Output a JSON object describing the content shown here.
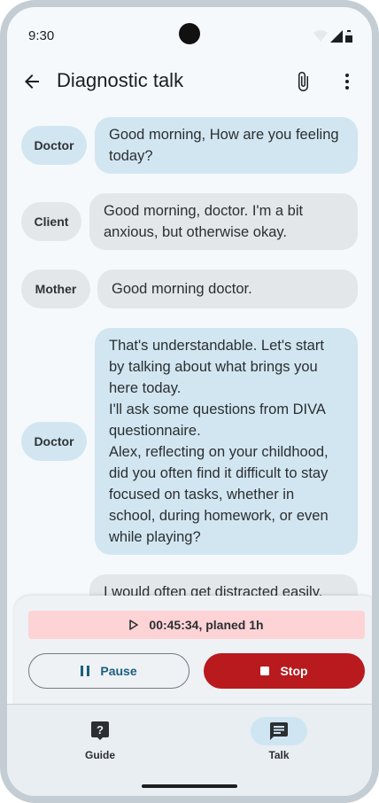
{
  "status_bar": {
    "time": "9:30"
  },
  "app_bar": {
    "title": "Diagnostic talk"
  },
  "messages": [
    {
      "speaker": "Doctor",
      "text": "Good morning, How are you feeling\ntoday?"
    },
    {
      "speaker": "Client",
      "text": "Good morning, doctor. I'm a bit\nanxious, but otherwise okay."
    },
    {
      "speaker": "Mother",
      "text": "Good morning doctor."
    },
    {
      "speaker": "Doctor",
      "text": "That's understandable. Let's start\nby talking about what brings you\nhere today.\nI'll ask some questions from DIVA\nquestionnaire.\nAlex, reflecting on your childhood,\ndid you often find it difficult to stay\nfocused on tasks, whether in\nschool, during homework, or even\nwhile playing?"
    },
    {
      "speaker": "",
      "text": "I would often get distracted easily."
    }
  ],
  "session": {
    "timer_text": "00:45:34, planed 1h",
    "pause_label": "Pause",
    "stop_label": "Stop"
  },
  "nav": [
    {
      "label": "Guide",
      "icon": "guide-question-icon",
      "active": false
    },
    {
      "label": "Talk",
      "icon": "chat-icon",
      "active": true
    }
  ],
  "colors": {
    "doctor_bubble": "#d2e6f1",
    "other_bubble": "#e3e7ea",
    "stop": "#b81a1e",
    "timer_bg": "#fdd3d6",
    "accent": "#1b5f7e"
  }
}
